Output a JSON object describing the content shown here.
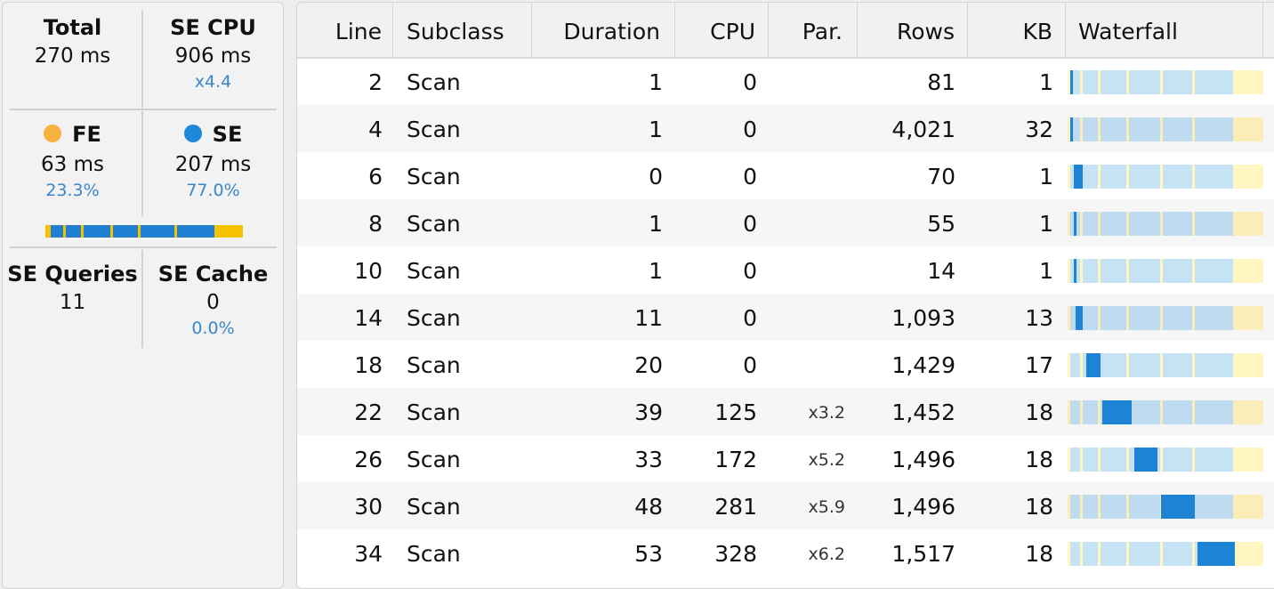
{
  "summary": {
    "total": {
      "label": "Total",
      "value": "270 ms"
    },
    "se_cpu": {
      "label": "SE CPU",
      "value": "906 ms",
      "ratio": "x4.4"
    },
    "fe": {
      "label": "FE",
      "value": "63 ms",
      "pct": "23.3%",
      "fraction": 0.233,
      "color": "#f8b23e"
    },
    "se": {
      "label": "SE",
      "value": "207 ms",
      "pct": "77.0%",
      "fraction": 0.77,
      "color": "#1e88d8"
    },
    "se_queries": {
      "label": "SE Queries",
      "value": "11"
    },
    "se_cache": {
      "label": "SE Cache",
      "value": "0",
      "pct": "0.0%"
    }
  },
  "table": {
    "columns": [
      "Line",
      "Subclass",
      "Duration",
      "CPU",
      "Par.",
      "Rows",
      "KB",
      "Waterfall"
    ],
    "rows": [
      {
        "line": "2",
        "subclass": "Scan",
        "duration": "1",
        "cpu": "0",
        "par": "",
        "rows": "81",
        "kb": "1"
      },
      {
        "line": "4",
        "subclass": "Scan",
        "duration": "1",
        "cpu": "0",
        "par": "",
        "rows": "4,021",
        "kb": "32"
      },
      {
        "line": "6",
        "subclass": "Scan",
        "duration": "0",
        "cpu": "0",
        "par": "",
        "rows": "70",
        "kb": "1"
      },
      {
        "line": "8",
        "subclass": "Scan",
        "duration": "1",
        "cpu": "0",
        "par": "",
        "rows": "55",
        "kb": "1"
      },
      {
        "line": "10",
        "subclass": "Scan",
        "duration": "1",
        "cpu": "0",
        "par": "",
        "rows": "14",
        "kb": "1"
      },
      {
        "line": "14",
        "subclass": "Scan",
        "duration": "11",
        "cpu": "0",
        "par": "",
        "rows": "1,093",
        "kb": "13"
      },
      {
        "line": "18",
        "subclass": "Scan",
        "duration": "20",
        "cpu": "0",
        "par": "",
        "rows": "1,429",
        "kb": "17"
      },
      {
        "line": "22",
        "subclass": "Scan",
        "duration": "39",
        "cpu": "125",
        "par": "x3.2",
        "rows": "1,452",
        "kb": "18"
      },
      {
        "line": "26",
        "subclass": "Scan",
        "duration": "33",
        "cpu": "172",
        "par": "x5.2",
        "rows": "1,496",
        "kb": "18"
      },
      {
        "line": "30",
        "subclass": "Scan",
        "duration": "48",
        "cpu": "281",
        "par": "x5.9",
        "rows": "1,496",
        "kb": "18"
      },
      {
        "line": "34",
        "subclass": "Scan",
        "duration": "53",
        "cpu": "328",
        "par": "x6.2",
        "rows": "1,517",
        "kb": "18"
      }
    ]
  },
  "colors": {
    "se_blue": "#1d83d4",
    "fe_yellow": "#f5c200",
    "light_blue": "#c6e2f5",
    "pale_yellow": "#fff6c2"
  }
}
